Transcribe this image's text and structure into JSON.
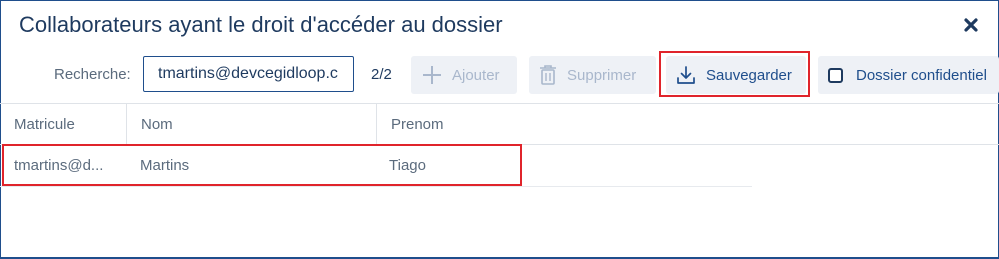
{
  "dialog": {
    "title": "Collaborateurs ayant le droit d'accéder au dossier",
    "close_icon": "close-icon"
  },
  "toolbar": {
    "search_label": "Recherche:",
    "search_value": "tmartins@devcegidloop.c",
    "result_count": "2/2",
    "add_label": "Ajouter",
    "delete_label": "Supprimer",
    "save_label": "Sauvegarder",
    "confidential_label": "Dossier confidentiel",
    "confidential_checked": false,
    "icons": {
      "add": "plus-icon",
      "delete": "trash-icon",
      "save": "download-icon"
    }
  },
  "table": {
    "columns": [
      "Matricule",
      "Nom",
      "Prenom"
    ],
    "rows": [
      [
        "tmartins@d...",
        "Martins",
        "Tiago"
      ]
    ]
  },
  "colors": {
    "accent": "#1f4e8c",
    "highlight": "#e0242b",
    "disabled": "#a9b7cc",
    "button_bg": "#eef1f6"
  }
}
